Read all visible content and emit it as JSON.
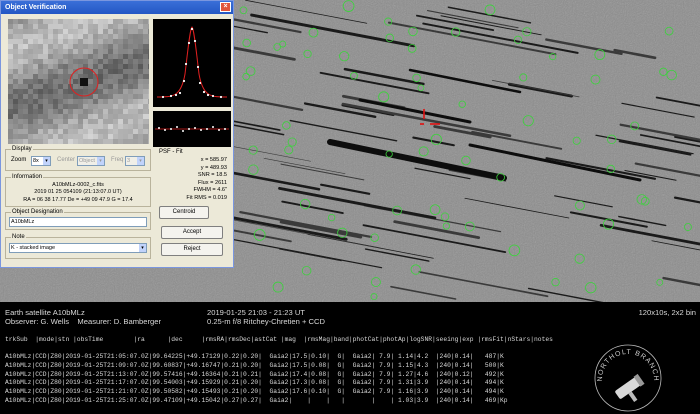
{
  "dialog": {
    "title": "Object Verification",
    "close_symbol": "×",
    "display_group": "Display",
    "zoom_label": "Zoom",
    "zoom_value": "8x",
    "center_label": "Center",
    "center_value": "Object",
    "freq_label": "Freq",
    "freq_value": "3",
    "psf_title": "PSF - Fit",
    "psf_lines": [
      "x = 585.97",
      "y = 489.93",
      "SNR = 18.5",
      "Flux = 2611",
      "FWHM = 4.6\"",
      "Fit RMS = 0.019"
    ],
    "centroid_button": "Centroid",
    "info_group": "Information",
    "info_lines": [
      "A10bMLz-0002_c.fits",
      "2019 01 25 054109 (21:13:07.0 UT)",
      "RA = 06 38 17.77   De = +49 09 47.9   G = 17.4"
    ],
    "designation_group": "Object Designation",
    "designation_value": "A10bMLz",
    "accept_button": "Accept",
    "note_group": "Note",
    "note_value": "K - stacked image",
    "reject_button": "Reject"
  },
  "bottom": {
    "object_line": "Earth satellite A10bMLz",
    "observer_line": "Observer: G. Wells    Measurer: D. Bamberger",
    "date_line": "2019-01-25 21:03 - 21:23 UT",
    "telescope_line": "0.25-m f/8 Ritchey-Chretien + CCD",
    "exposure_line": "120x10s, 2x2 bin",
    "header": "trkSub  |mode|stn |obsTime        |ra      |dec     |rmsRA|rmsDec|astCat |mag  |rmsMag|band|photCat|photAp|logSNR|seeing|exp |rmsFit|nStars|notes",
    "rows": [
      "A10bMLz|CCD|Z80|2019-01-25T21:05:07.0Z|99.64225|+49.17129|0.22|0.20|  Gaia2|17.5|0.10|  G|  Gaia2| 7.9| 1.14|4.2  |240|0.14|   487|K",
      "A10bMLz|CCD|Z80|2019-01-25T21:09:07.0Z|99.60837|+49.16747|0.21|0.20|  Gaia2|17.5|0.08|  G|  Gaia2| 7.9| 1.15|4.3  |240|0.14|   500|K",
      "A10bMLz|CCD|Z80|2019-01-25T21:13:07.0Z|99.57416|+49.16364|0.21|0.21|  Gaia2|17.4|0.08|  G|  Gaia2| 7.9| 1.27|4.6  |240|0.12|   492|K",
      "A10bMLz|CCD|Z80|2019-01-25T21:17:07.0Z|99.54003|+49.15929|0.21|0.20|  Gaia2|17.3|0.08|  G|  Gaia2| 7.9| 1.31|3.9  |240|0.14|   494|K",
      "A10bMLz|CCD|Z80|2019-01-25T21:21:07.0Z|99.50582|+49.15493|0.21|0.20|  Gaia2|17.6|0.10|  G|  Gaia2| 7.9| 1.16|3.9  |240|0.14|   494|K",
      "A10bMLz|CCD|Z80|2019-01-25T21:25:07.0Z|99.47109|+49.15042|0.27|0.27|  Gaia2|    |    |   |       |    | 1.03|3.9  |240|0.14|   469|Kp"
    ],
    "logo_text": "NORTHOLT BRANCH"
  },
  "colors": {
    "sky_bg": "#8c8c8c",
    "circle": "#3cd23c",
    "marker": "#e01010",
    "psf_curve": "#e02020"
  }
}
